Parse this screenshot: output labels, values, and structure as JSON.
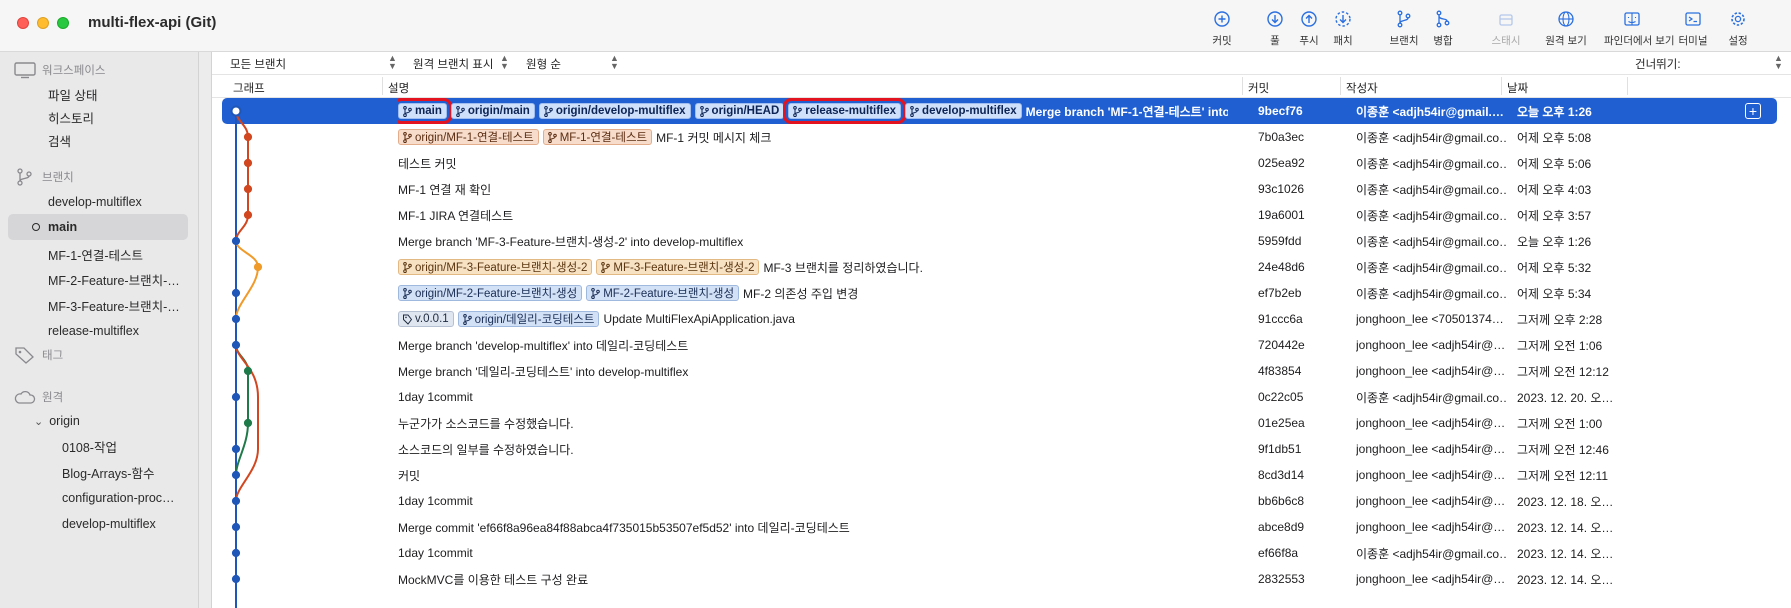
{
  "window": {
    "title": "multi-flex-api (Git)"
  },
  "toolbar": [
    {
      "name": "commit-button",
      "icon": "plus-circle-icon",
      "label": "커밋",
      "disabled": false
    },
    {
      "name": "pull-button",
      "icon": "arrow-down-circle-icon",
      "label": "풀",
      "disabled": false
    },
    {
      "name": "push-button",
      "icon": "arrow-up-circle-icon",
      "label": "푸시",
      "disabled": false
    },
    {
      "name": "fetch-button",
      "icon": "fetch-dashed-circle-icon",
      "label": "패치",
      "disabled": false
    },
    {
      "name": "branch-button",
      "icon": "branch-icon",
      "label": "브랜치",
      "disabled": false
    },
    {
      "name": "merge-button",
      "icon": "merge-icon",
      "label": "병합",
      "disabled": false
    },
    {
      "name": "stash-button",
      "icon": "stash-icon",
      "label": "스태시",
      "disabled": true
    },
    {
      "name": "show-remote-button",
      "icon": "globe-icon",
      "label": "원격 보기",
      "disabled": false
    },
    {
      "name": "show-in-finder-button",
      "icon": "finder-icon",
      "label": "파인더에서 보기",
      "disabled": false
    },
    {
      "name": "terminal-button",
      "icon": "terminal-icon",
      "label": "터미널",
      "disabled": false
    },
    {
      "name": "settings-button",
      "icon": "gear-icon",
      "label": "설정",
      "disabled": false
    }
  ],
  "sidebar": {
    "workspace": {
      "title": "워크스페이스",
      "items": [
        "파일 상태",
        "히스토리",
        "검색"
      ]
    },
    "branches": {
      "title": "브랜치",
      "items": [
        "develop-multiflex",
        "main",
        "MF-1-연결-테스트",
        "MF-2-Feature-브랜치-…",
        "MF-3-Feature-브랜치-…",
        "release-multiflex"
      ],
      "current": "main"
    },
    "tags": {
      "title": "태그"
    },
    "remotes": {
      "title": "원격",
      "origin": "origin",
      "items": [
        "0108-작업",
        "Blog-Arrays-함수",
        "configuration-proc…",
        "develop-multiflex"
      ]
    }
  },
  "filters": {
    "branches": "모든 브랜치",
    "remote": "원격 브랜치 표시",
    "order": "원형 순",
    "jump": "건너뛰기:"
  },
  "columns": {
    "graph": "그래프",
    "description": "설명",
    "commit": "커밋",
    "author": "작성자",
    "date": "날짜"
  },
  "commits": [
    {
      "tags": [
        {
          "label": "main",
          "kind": "branch",
          "highlight": true
        },
        {
          "label": "origin/main",
          "kind": "branch"
        },
        {
          "label": "origin/develop-multiflex",
          "kind": "branch"
        },
        {
          "label": "origin/HEAD",
          "kind": "branch"
        },
        {
          "label": "release-multiflex",
          "kind": "branch",
          "highlight": true
        },
        {
          "label": "develop-multiflex",
          "kind": "branch"
        }
      ],
      "message": "Merge branch 'MF-1-연결-테스트' into develop-multiflex",
      "hash": "9becf76",
      "author": "이종훈 <adjh54ir@gmail.…",
      "date": "오늘 오후 1:26",
      "selected": true
    },
    {
      "tags": [
        {
          "label": "origin/MF-1-연결-테스트",
          "kind": "branch",
          "color": "orange"
        },
        {
          "label": "MF-1-연결-테스트",
          "kind": "branch",
          "color": "orange"
        }
      ],
      "message": "MF-1 커밋 메시지 체크",
      "hash": "7b0a3ec",
      "author": "이종훈 <adjh54ir@gmail.co…",
      "date": "어제 오후 5:08"
    },
    {
      "tags": [],
      "message": "테스트 커밋",
      "hash": "025ea92",
      "author": "이종훈 <adjh54ir@gmail.co…",
      "date": "어제 오후 5:06"
    },
    {
      "tags": [],
      "message": "MF-1 연결 재 확인",
      "hash": "93c1026",
      "author": "이종훈 <adjh54ir@gmail.co…",
      "date": "어제 오후 4:03"
    },
    {
      "tags": [],
      "message": "MF-1 JIRA 연결테스트",
      "hash": "19a6001",
      "author": "이종훈 <adjh54ir@gmail.co…",
      "date": "어제 오후 3:57"
    },
    {
      "tags": [],
      "message": "Merge branch 'MF-3-Feature-브랜치-생성-2' into develop-multiflex",
      "hash": "5959fdd",
      "author": "이종훈 <adjh54ir@gmail.co…",
      "date": "오늘 오후 1:26"
    },
    {
      "tags": [
        {
          "label": "origin/MF-3-Feature-브랜치-생성-2",
          "kind": "branch",
          "color": "peach"
        },
        {
          "label": "MF-3-Feature-브랜치-생성-2",
          "kind": "branch",
          "color": "peach"
        }
      ],
      "message": "MF-3 브랜치를 정리하였습니다.",
      "hash": "24e48d6",
      "author": "이종훈 <adjh54ir@gmail.co…",
      "date": "어제 오후 5:32"
    },
    {
      "tags": [
        {
          "label": "origin/MF-2-Feature-브랜치-생성",
          "kind": "branch",
          "color": "blue"
        },
        {
          "label": "MF-2-Feature-브랜치-생성",
          "kind": "branch",
          "color": "blue"
        }
      ],
      "message": "MF-2 의존성 주입 변경",
      "hash": "ef7b2eb",
      "author": "이종훈 <adjh54ir@gmail.co…",
      "date": "어제 오후 5:34"
    },
    {
      "tags": [
        {
          "label": "v.0.0.1",
          "kind": "tag",
          "color": "gray"
        },
        {
          "label": "origin/데일리-코딩테스트",
          "kind": "branch",
          "color": "blue"
        }
      ],
      "message": "Update MultiFlexApiApplication.java",
      "hash": "91ccc6a",
      "author": "jonghoon_lee <70501374…",
      "date": "그저께 오후 2:28"
    },
    {
      "tags": [],
      "message": "Merge branch 'develop-multiflex' into 데일리-코딩테스트",
      "hash": "720442e",
      "author": "jonghoon_lee <adjh54ir@…",
      "date": "그저께 오전 1:06"
    },
    {
      "tags": [],
      "message": "Merge branch '데일리-코딩테스트' into develop-multiflex",
      "hash": "4f83854",
      "author": "jonghoon_lee <adjh54ir@…",
      "date": "그저께 오전 12:12"
    },
    {
      "tags": [],
      "message": "1day 1commit",
      "hash": "0c22c05",
      "author": "이종훈 <adjh54ir@gmail.co…",
      "date": "2023. 12. 20. 오…"
    },
    {
      "tags": [],
      "message": "누군가가 소스코드를 수정했습니다.",
      "hash": "01e25ea",
      "author": "jonghoon_lee <adjh54ir@…",
      "date": "그저께 오전 1:00"
    },
    {
      "tags": [],
      "message": "소스코드의 일부를 수정하였습니다.",
      "hash": "9f1db51",
      "author": "jonghoon_lee <adjh54ir@…",
      "date": "그저께 오전 12:46"
    },
    {
      "tags": [],
      "message": "커밋",
      "hash": "8cd3d14",
      "author": "jonghoon_lee <adjh54ir@…",
      "date": "그저께 오전 12:11"
    },
    {
      "tags": [],
      "message": "1day 1commit",
      "hash": "bb6b6c8",
      "author": "jonghoon_lee <adjh54ir@…",
      "date": "2023. 12. 18. 오…"
    },
    {
      "tags": [],
      "message": "Merge commit 'ef66f8a96ea84f88abca4f735015b53507ef5d52' into 데일리-코딩테스트",
      "hash": "abce8d9",
      "author": "jonghoon_lee <adjh54ir@…",
      "date": "2023. 12. 14. 오…"
    },
    {
      "tags": [],
      "message": "1day 1commit",
      "hash": "ef66f8a",
      "author": "이종훈 <adjh54ir@gmail.co…",
      "date": "2023. 12. 14. 오…"
    },
    {
      "tags": [],
      "message": "MockMVC를 이용한 테스트 구성 완료",
      "hash": "2832553",
      "author": "jonghoon_lee <adjh54ir@…",
      "date": "2023. 12. 14. 오…"
    }
  ],
  "colors": {
    "selection": "#1f5fd1",
    "highlight_outline": "#e3131f",
    "lane_blue": "#1f57b8",
    "lane_red": "#d2471f",
    "lane_orange": "#f09a2a",
    "lane_green": "#1f7a4a"
  }
}
